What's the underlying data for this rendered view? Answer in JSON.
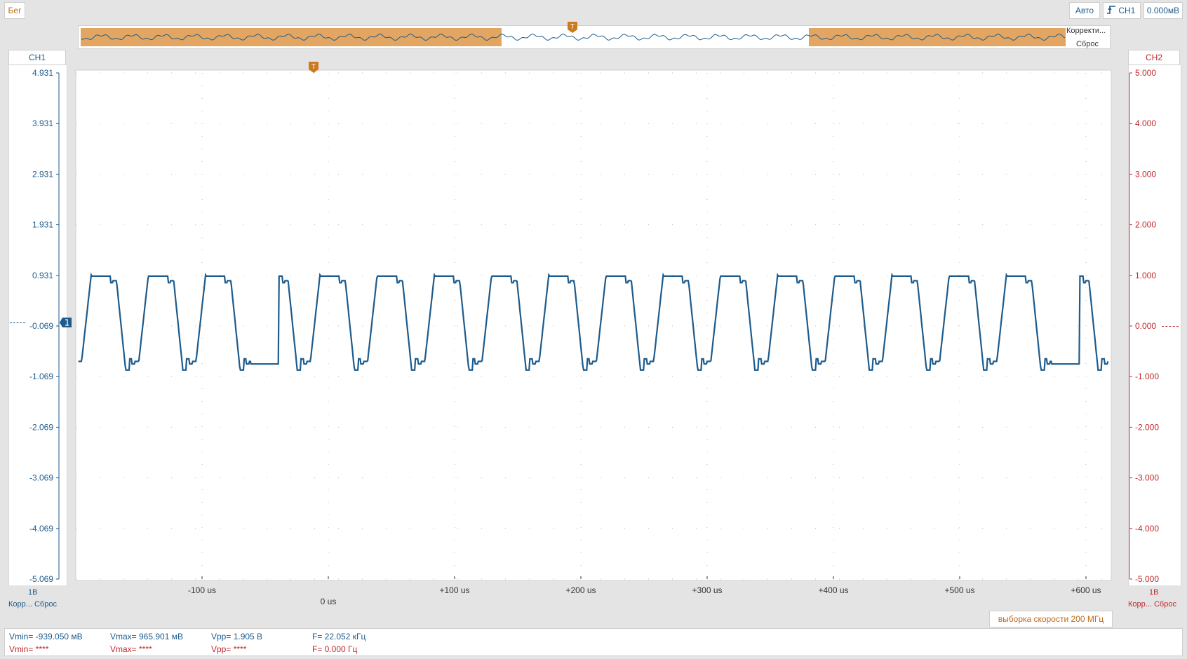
{
  "header": {
    "status": "Бег",
    "mode": "Авто",
    "trigger_channel": "CH1",
    "trigger_level": "0.000мВ"
  },
  "overview": {
    "correction_label": "Корректи...",
    "reset_label": "Сброс"
  },
  "channels": {
    "ch1": {
      "label": "CH1",
      "scale": "1В",
      "reset_label": "Корр... Сброс",
      "ticks": [
        "4.931",
        "3.931",
        "2.931",
        "1.931",
        "0.931",
        "-0.069",
        "-1.069",
        "-2.069",
        "-3.069",
        "-4.069",
        "-5.069"
      ]
    },
    "ch2": {
      "label": "CH2",
      "scale": "1В",
      "reset_label": "Корр... Сброс",
      "ticks": [
        "5.000",
        "4.000",
        "3.000",
        "2.000",
        "1.000",
        "0.000",
        "-1.000",
        "-2.000",
        "-3.000",
        "-4.000",
        "-5.000"
      ]
    }
  },
  "time_axis": {
    "ticks": [
      "-100 us",
      "0 us",
      "+100 us",
      "+200 us",
      "+300 us",
      "+400 us",
      "+500 us",
      "+600 us"
    ]
  },
  "sample_rate": "выборка скорости 200 МГц",
  "measurements": {
    "ch1": {
      "vmin": "Vmin= -939.050 мВ",
      "vmax": "Vmax= 965.901 мВ",
      "vpp": "Vpp= 1.905 В",
      "freq": "F= 22.052 кГц"
    },
    "ch2": {
      "vmin": "Vmin= ****",
      "vmax": "Vmax= ****",
      "vpp": "Vpp= ****",
      "freq": "F= 0.000 Гц"
    }
  },
  "colors": {
    "ch1": "#1d5b8c",
    "ch2": "#c0282d",
    "trigger": "#cc7a1e",
    "overview_highlight": "#e3a662"
  },
  "chart_data": {
    "type": "line",
    "x_unit": "us",
    "y_unit": "V",
    "xlim": [
      -200,
      620
    ],
    "ylim": [
      -5.069,
      4.931
    ],
    "series": [
      {
        "name": "CH1",
        "color": "#1d5b8c",
        "period_us": 45.3,
        "phase_us": -175,
        "vmax": 0.966,
        "vmin": -0.939,
        "missing_cycles": [
          2,
          16
        ]
      }
    ]
  }
}
